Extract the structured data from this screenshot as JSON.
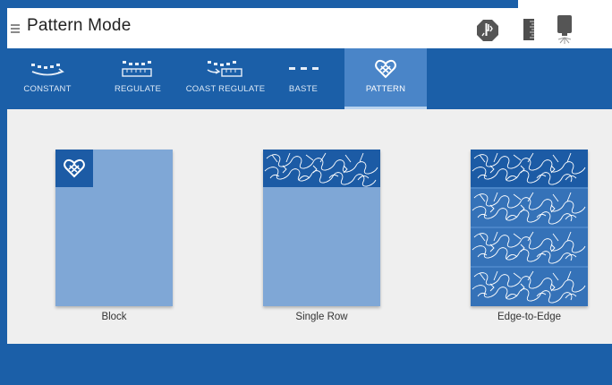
{
  "header": {
    "title": "Pattern Mode",
    "icons": [
      "stop-needle-icon",
      "ruler-icon",
      "laser-sensor-icon"
    ]
  },
  "tabs": [
    {
      "label": "CONSTANT",
      "icon": "constant-stitch-icon",
      "active": false
    },
    {
      "label": "REGULATE",
      "icon": "regulate-stitch-icon",
      "active": false
    },
    {
      "label": "COAST REGULATE",
      "icon": "coast-regulate-icon",
      "active": false
    },
    {
      "label": "BASTE",
      "icon": "baste-icon",
      "active": false
    },
    {
      "label": "PATTERN",
      "icon": "pattern-heart-icon",
      "active": true
    }
  ],
  "cards": [
    {
      "label": "Block",
      "preview": "block-preview"
    },
    {
      "label": "Single Row",
      "preview": "single-row-preview"
    },
    {
      "label": "Edge-to-Edge",
      "preview": "edge-to-edge-preview"
    }
  ],
  "colors": {
    "frame_blue": "#1b5fa8",
    "active_tab": "#4a85c8",
    "card_light": "#7fa7d6",
    "pattern_dark": "#1c5ba5",
    "content_bg": "#efefef"
  }
}
